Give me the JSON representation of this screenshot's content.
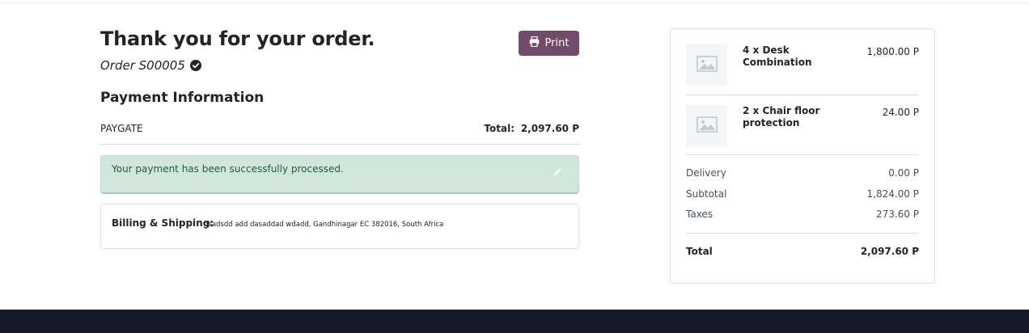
{
  "confirmation": {
    "title": "Thank you for your order.",
    "order_ref": "Order S00005",
    "print_label": "Print"
  },
  "payment": {
    "section_title": "Payment Information",
    "method": "PAYGATE",
    "total_label": "Total:",
    "total_value": "2,097.60 P",
    "success_message": "Your payment has been successfully processed."
  },
  "address": {
    "label": "Billing & Shipping:",
    "value": "dsadsdd add dasaddad wdadd, Gandhinagar EC 382016, South Africa"
  },
  "summary": {
    "items": [
      {
        "name": "4 x Desk Combination",
        "price": "1,800.00 P"
      },
      {
        "name": "2 x Chair floor protection",
        "price": "24.00 P"
      }
    ],
    "delivery_label": "Delivery",
    "delivery_value": "0.00 P",
    "subtotal_label": "Subtotal",
    "subtotal_value": "1,824.00 P",
    "taxes_label": "Taxes",
    "taxes_value": "273.60 P",
    "total_label": "Total",
    "total_value": "2,097.60 P"
  },
  "colors": {
    "primary": "#714b67",
    "success_bg": "#d1e7dd",
    "success_text": "#1c5d3a",
    "footer": "#141a28"
  }
}
